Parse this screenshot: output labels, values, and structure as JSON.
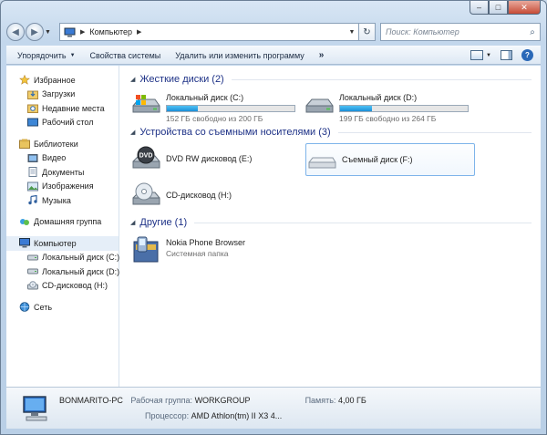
{
  "window": {
    "minimize": "–",
    "maximize": "□",
    "close": "✕"
  },
  "address": {
    "root_icon": "computer-icon",
    "path": "Компьютер",
    "search_placeholder": "Поиск: Компьютер"
  },
  "commands": [
    {
      "label": "Упорядочить",
      "dropdown": true
    },
    {
      "label": "Свойства системы"
    },
    {
      "label": "Удалить или изменить программу"
    },
    {
      "label": "»"
    }
  ],
  "nav": {
    "favorites": {
      "label": "Избранное",
      "items": [
        "Загрузки",
        "Недавние места",
        "Рабочий стол"
      ]
    },
    "libraries": {
      "label": "Библиотеки",
      "items": [
        "Видео",
        "Документы",
        "Изображения",
        "Музыка"
      ]
    },
    "homegroup": "Домашняя группа",
    "computer": {
      "label": "Компьютер",
      "items": [
        "Локальный диск (C:)",
        "Локальный диск (D:)",
        "CD-дисковод (H:)"
      ]
    },
    "network": "Сеть"
  },
  "groups": {
    "hdd": {
      "title": "Жесткие диски (2)",
      "drives": [
        {
          "name": "Локальный диск (C:)",
          "free": "152 ГБ свободно из 200 ГБ",
          "used_fraction": 0.24
        },
        {
          "name": "Локальный диск (D:)",
          "free": "199 ГБ свободно из 264 ГБ",
          "used_fraction": 0.25
        }
      ]
    },
    "removable": {
      "title": "Устройства со съемными носителями (3)",
      "drives": [
        {
          "name": "DVD RW дисковод (E:)",
          "icon_text": "DVD"
        },
        {
          "name": "Съемный диск (F:)"
        },
        {
          "name": "CD-дисковод (H:)"
        }
      ]
    },
    "other": {
      "title": "Другие (1)",
      "items": [
        {
          "name": "Nokia Phone Browser",
          "type": "Системная папка"
        }
      ]
    }
  },
  "details": {
    "pc_name": "BONMARITO-PC",
    "workgroup_label": "Рабочая группа:",
    "workgroup": "WORKGROUP",
    "memory_label": "Память:",
    "memory": "4,00 ГБ",
    "cpu_label": "Процессор:",
    "cpu": "AMD Athlon(tm) II X3 4..."
  }
}
